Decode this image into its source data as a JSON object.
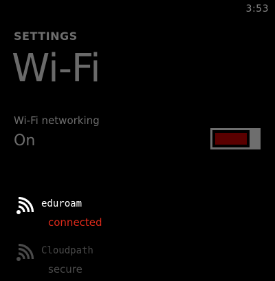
{
  "status_bar": {
    "time": "3:53"
  },
  "header": {
    "section_label": "SETTINGS",
    "title": "Wi-Fi"
  },
  "wifi_toggle": {
    "label": "Wi-Fi networking",
    "state": "On",
    "on": true
  },
  "networks": [
    {
      "name": "eduroam",
      "status": "connected",
      "icon": "wifi-icon"
    },
    {
      "name": "Cloudpath",
      "status": "secure",
      "icon": "wifi-icon"
    }
  ],
  "colors": {
    "background": "#000000",
    "accent": "#5a0000",
    "connected_text": "#e02a1a",
    "muted_text": "#6e6e6e",
    "dim_text": "#4a4a4a"
  }
}
